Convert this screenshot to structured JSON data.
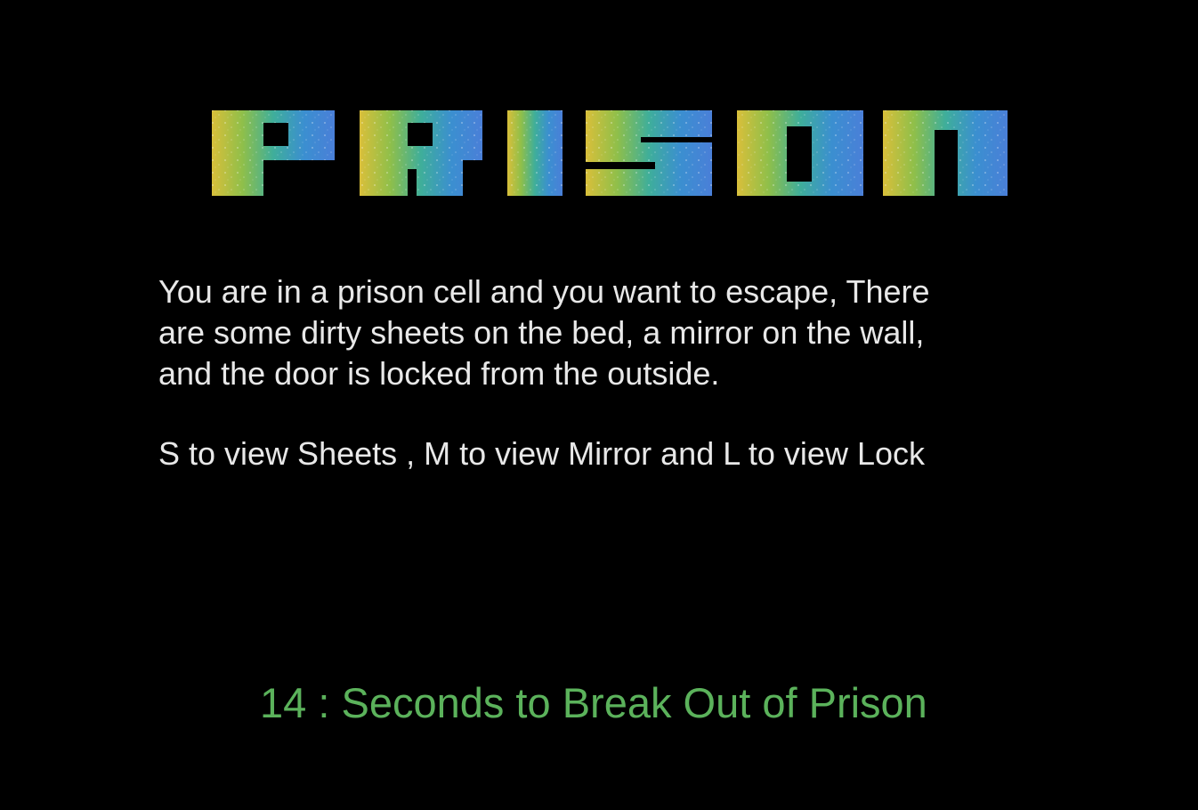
{
  "game": {
    "title": "PRISON",
    "description": "You are in a prison cell and you want to escape, There\nare some dirty sheets on the bed, a mirror on the wall,\nand the door is locked from the outside.",
    "instructions": "S to view Sheets , M to view Mirror and L to view Lock",
    "timer": {
      "seconds": "14",
      "separator": " : ",
      "label": "Seconds to Break Out of Prison"
    }
  },
  "colors": {
    "background": "#000000",
    "text": "#e8e8e8",
    "timer": "#5bb25b",
    "logo_gradient": [
      "#d9bf3a",
      "#8fbf4a",
      "#3fae9a",
      "#3b8fd0",
      "#4a7fd8"
    ]
  }
}
